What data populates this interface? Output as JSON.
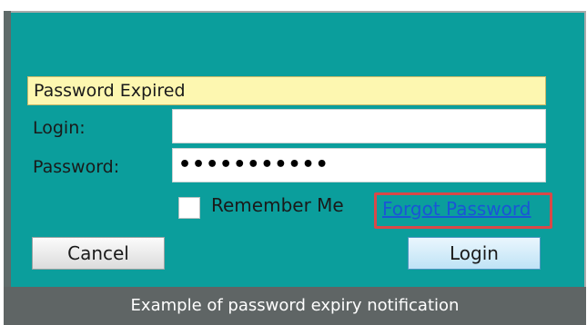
{
  "dialog": {
    "banner_text": "Password Expired",
    "login_label": "Login:",
    "login_value": "",
    "password_label": "Password:",
    "password_value": "•••••••••••",
    "remember_label": "Remember Me",
    "remember_checked": false,
    "forgot_link": "Forgot Password",
    "cancel_label": "Cancel",
    "login_button": "Login"
  },
  "caption": "Example of password expiry notification",
  "colors": {
    "background": "#0b9e9c",
    "banner": "#fdf7b0",
    "highlight": "#d94848",
    "link": "#1a55d6"
  }
}
